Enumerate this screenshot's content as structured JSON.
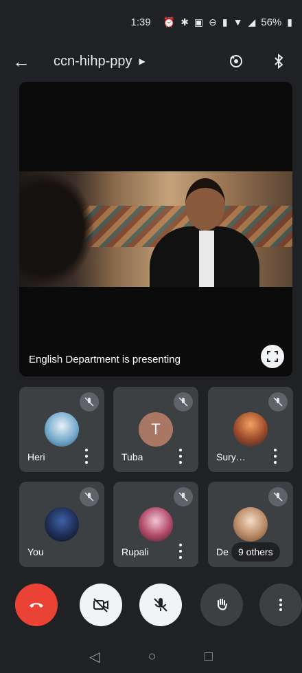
{
  "status_bar": {
    "time": "1:39",
    "battery": "56%",
    "icons": [
      "alarm-icon",
      "bluetooth-icon",
      "wifi-calling-icon",
      "dnd-icon",
      "vibrate-icon",
      "wifi-icon",
      "signal-icon",
      "battery-icon"
    ]
  },
  "app_bar": {
    "meeting_code": "ccn-hihp-ppy",
    "icons": [
      "back-arrow-icon",
      "switch-camera-icon",
      "bluetooth-audio-icon"
    ]
  },
  "presentation": {
    "presenting_text": "English Department is presenting"
  },
  "participants": [
    {
      "name": "Heri",
      "avatar": "photo",
      "muted": true
    },
    {
      "name": "Tuba",
      "avatar": "T",
      "muted": true,
      "avatar_color": "#a97763"
    },
    {
      "name": "Sury…",
      "avatar": "photo",
      "muted": true
    },
    {
      "name": "You",
      "avatar": "photo",
      "muted": true
    },
    {
      "name": "Rupali",
      "avatar": "photo",
      "muted": true
    },
    {
      "name": "De",
      "avatar": "photo",
      "muted": true
    }
  ],
  "others_chip": "9 others",
  "controls": {
    "end_call_color": "#ea4335",
    "icons": [
      "end-call-icon",
      "camera-off-icon",
      "mic-off-icon",
      "raise-hand-icon",
      "more-options-icon"
    ]
  },
  "nav_bar": {
    "icons": [
      "nav-back-icon",
      "nav-home-icon",
      "nav-recents-icon"
    ]
  }
}
